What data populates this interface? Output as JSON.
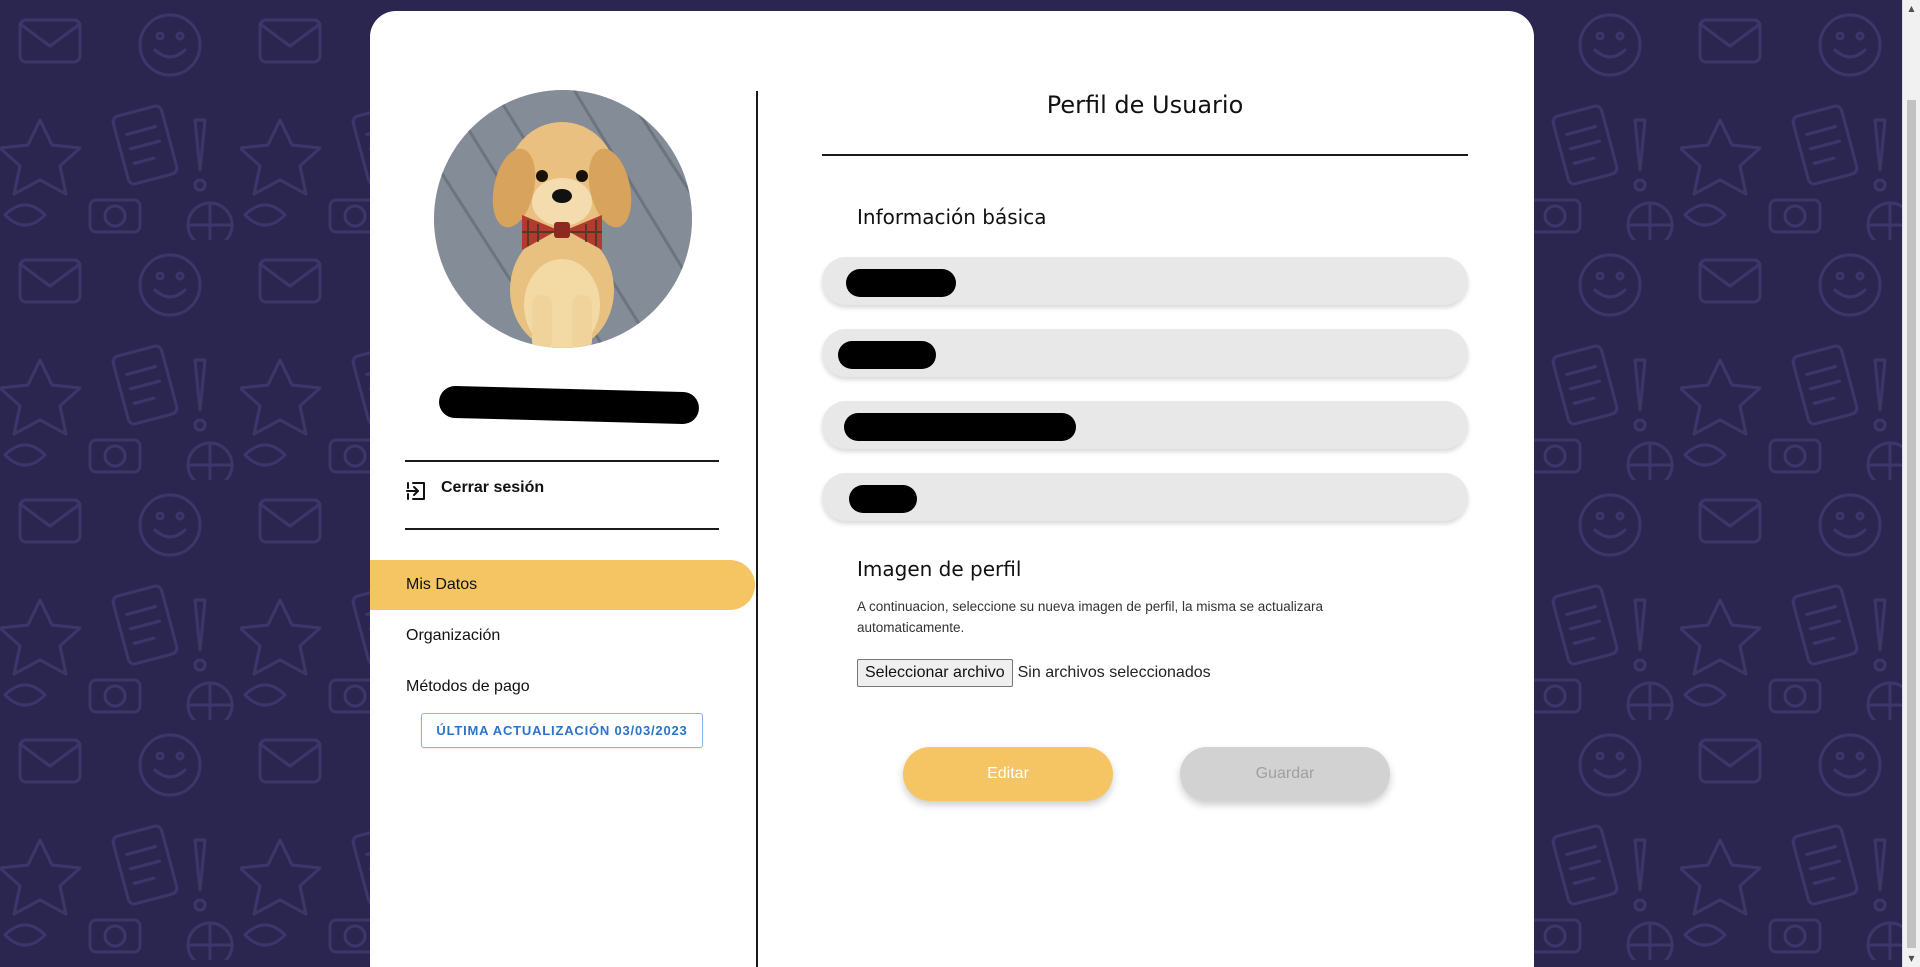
{
  "colors": {
    "background": "#2b2650",
    "accent": "#f5c563",
    "badge_blue": "#2a74c9"
  },
  "sidebar": {
    "avatar_alt": "puppy-with-bowtie",
    "logout_label": "Cerrar sesión",
    "logout_icon": "logout-icon",
    "nav": [
      {
        "label": "Mis Datos",
        "active": true
      },
      {
        "label": "Organización",
        "active": false
      },
      {
        "label": "Métodos de pago",
        "active": false
      }
    ],
    "last_update": "ÚLTIMA ACTUALIZACIÓN 03/03/2023"
  },
  "main": {
    "title": "Perfil de Usuario",
    "basic_info_heading": "Información básica",
    "profile_image_heading": "Imagen de perfil",
    "profile_image_help": "A continuacion, seleccione su nueva imagen de perfil, la misma se actualizara automaticamente.",
    "file_button_label": "Seleccionar archivo",
    "file_status": "Sin archivos seleccionados",
    "edit_label": "Editar",
    "save_label": "Guardar"
  }
}
